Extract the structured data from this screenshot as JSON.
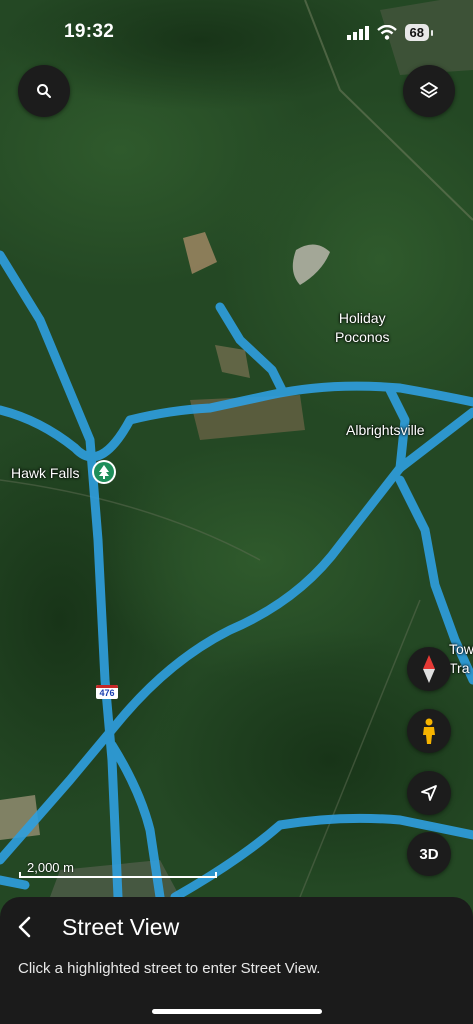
{
  "status_bar": {
    "time": "19:32",
    "battery": "68"
  },
  "map": {
    "labels": {
      "holiday_poconos": [
        "Holiday",
        "Poconos"
      ],
      "albrightsville": "Albrightsville",
      "hawk_falls": "Hawk Falls",
      "town_partial": [
        "Tow",
        "Tra"
      ]
    },
    "route_shield": "476",
    "scale": "2,000 m",
    "highlight_color": "#2f9fe0"
  },
  "controls": {
    "three_d": "3D"
  },
  "street_view": {
    "title": "Street View",
    "description": "Click a highlighted street to enter Street View."
  }
}
